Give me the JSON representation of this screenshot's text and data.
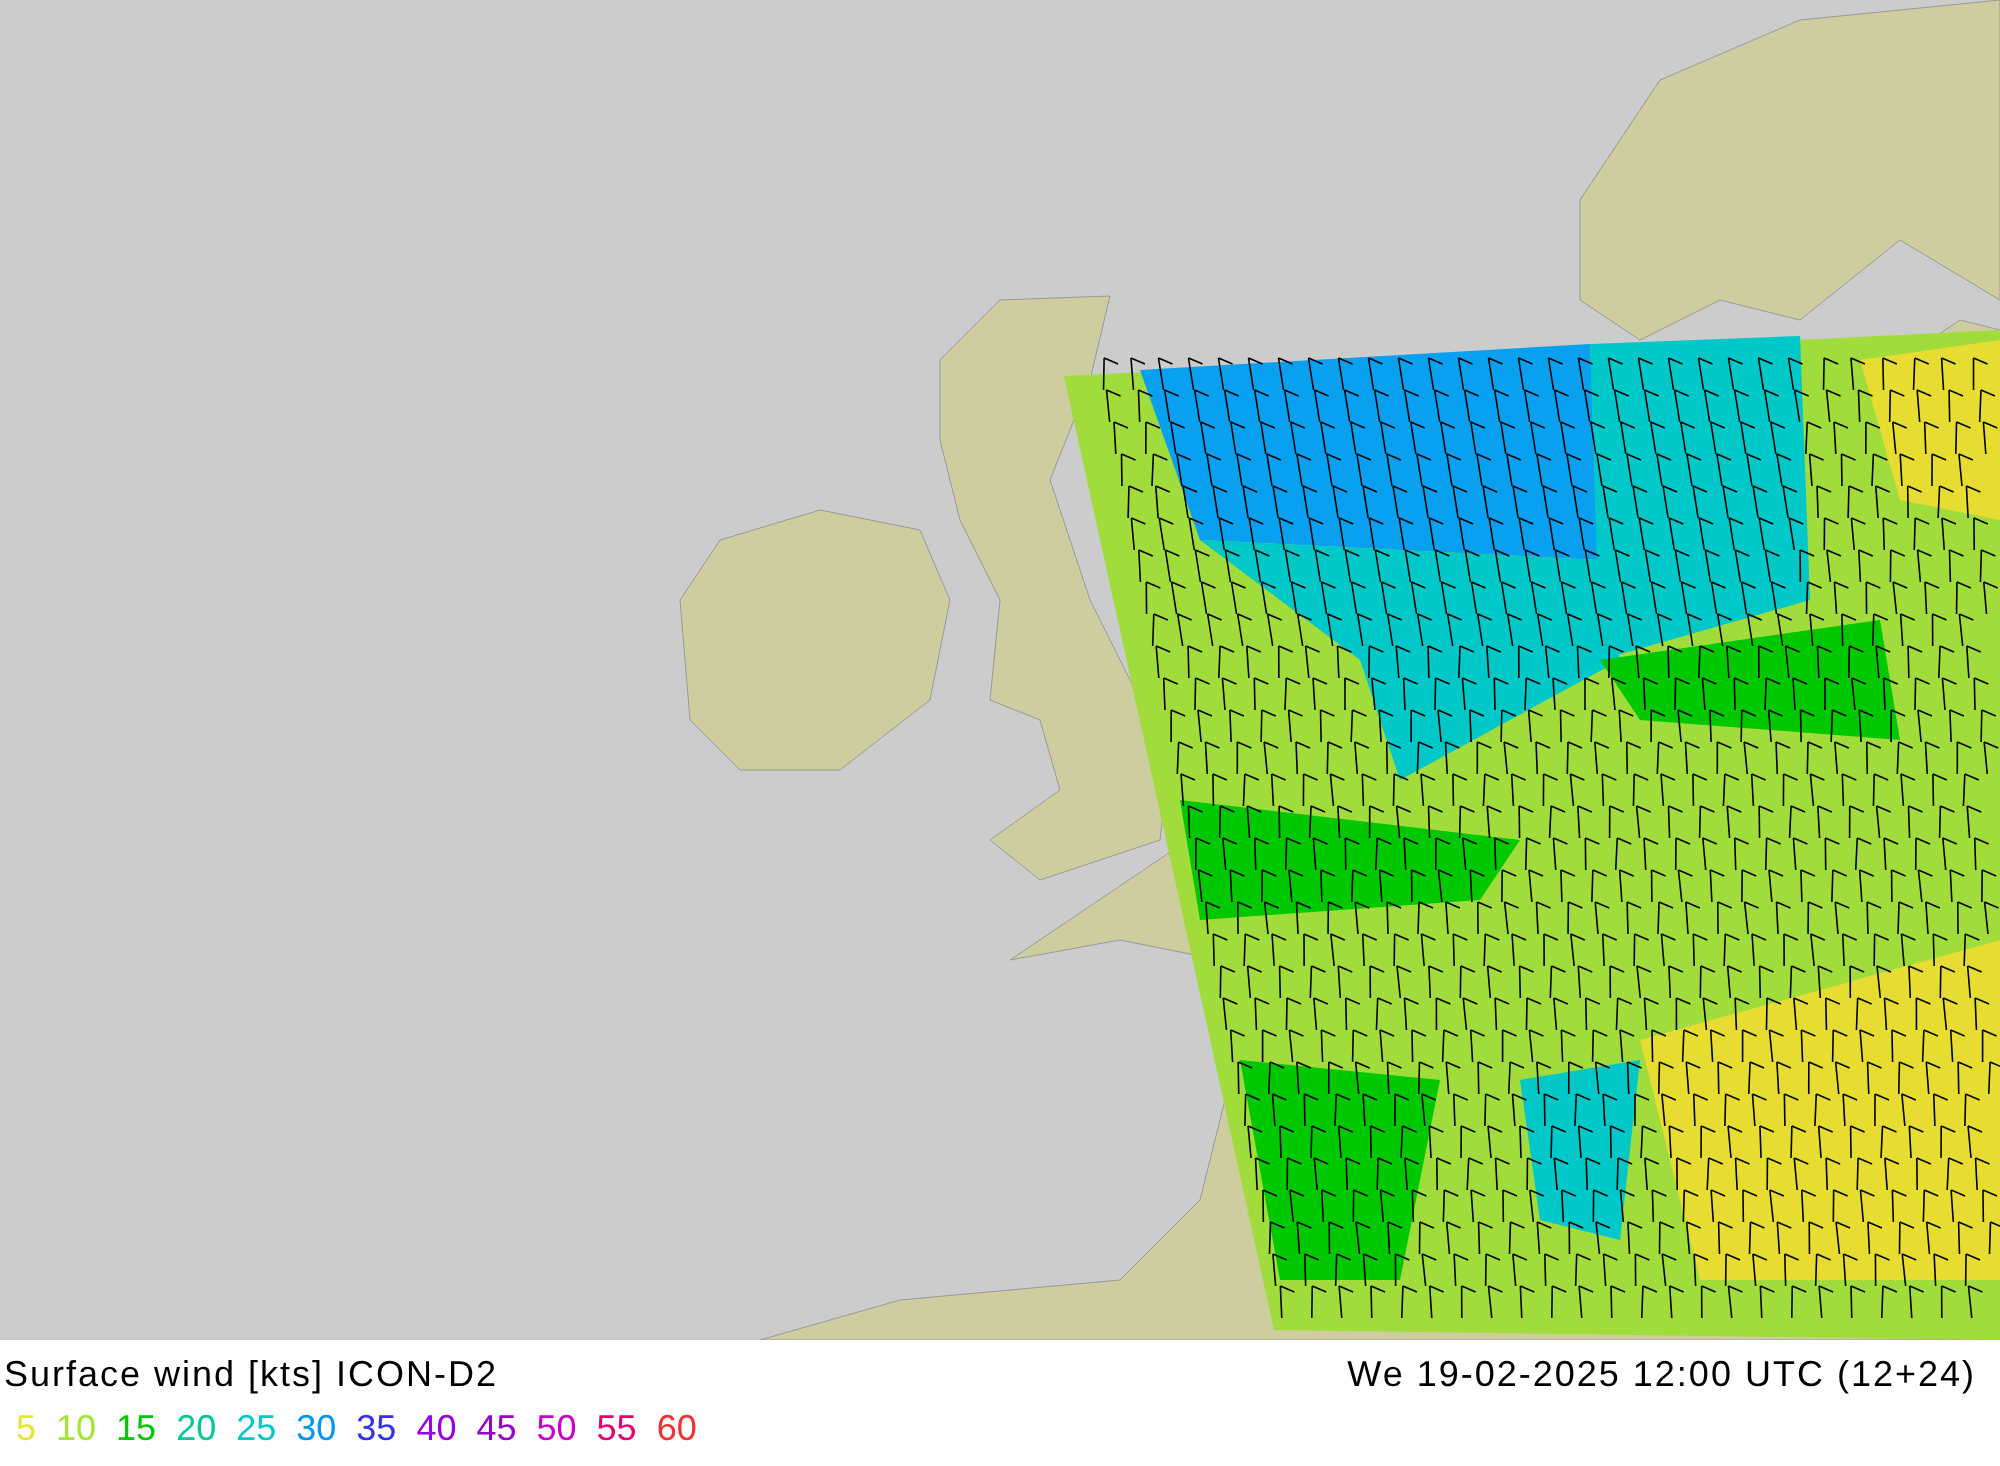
{
  "title": "Surface wind [kts] ICON-D2",
  "valid_time": "We 19-02-2025 12:00 UTC (12+24)",
  "legend": [
    {
      "label": "5",
      "color": "#e6e632"
    },
    {
      "label": "10",
      "color": "#a0e632"
    },
    {
      "label": "15",
      "color": "#00c800"
    },
    {
      "label": "20",
      "color": "#00c896"
    },
    {
      "label": "25",
      "color": "#00c8c8"
    },
    {
      "label": "30",
      "color": "#0096f0"
    },
    {
      "label": "35",
      "color": "#3232f0"
    },
    {
      "label": "40",
      "color": "#9600e6"
    },
    {
      "label": "45",
      "color": "#9600c8"
    },
    {
      "label": "50",
      "color": "#c800c8"
    },
    {
      "label": "55",
      "color": "#e6006e"
    },
    {
      "label": "60",
      "color": "#f03232"
    }
  ]
}
